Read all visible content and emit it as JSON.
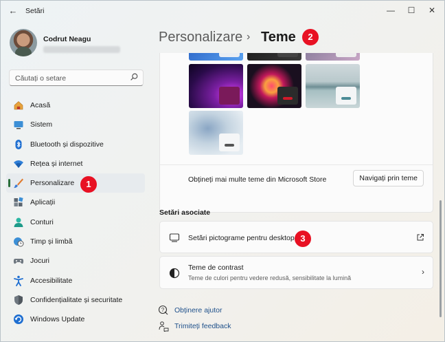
{
  "window": {
    "title": "Setări",
    "controls": [
      "minimize",
      "maximize",
      "close"
    ]
  },
  "user": {
    "name": "Codrut Neagu"
  },
  "search": {
    "placeholder": "Căutați o setare"
  },
  "sidebar": {
    "items": [
      {
        "label": "Acasă",
        "icon": "home-icon",
        "active": false
      },
      {
        "label": "Sistem",
        "icon": "system-icon",
        "active": false
      },
      {
        "label": "Bluetooth și dispozitive",
        "icon": "bluetooth-icon",
        "active": false
      },
      {
        "label": "Rețea și internet",
        "icon": "network-icon",
        "active": false
      },
      {
        "label": "Personalizare",
        "icon": "brush-icon",
        "active": true
      },
      {
        "label": "Aplicații",
        "icon": "apps-icon",
        "active": false
      },
      {
        "label": "Conturi",
        "icon": "account-icon",
        "active": false
      },
      {
        "label": "Timp și limbă",
        "icon": "clock-globe-icon",
        "active": false
      },
      {
        "label": "Jocuri",
        "icon": "gamepad-icon",
        "active": false
      },
      {
        "label": "Accesibilitate",
        "icon": "accessibility-icon",
        "active": false
      },
      {
        "label": "Confidențialitate și securitate",
        "icon": "shield-icon",
        "active": false
      },
      {
        "label": "Windows Update",
        "icon": "update-icon",
        "active": false
      }
    ]
  },
  "breadcrumb": {
    "parent": "Personalizare",
    "separator": "›",
    "current": "Teme"
  },
  "annotations": {
    "badge1": "1",
    "badge2": "2",
    "badge3": "3",
    "color": "#e81123"
  },
  "themes": {
    "more_text": "Obțineți mai multe teme din Microsoft Store",
    "browse_button": "Navigați prin teme"
  },
  "related": {
    "section_title": "Setări asociate",
    "desktop_icons": "Setări pictograme pentru desktop",
    "contrast_title": "Teme de contrast",
    "contrast_subtitle": "Teme de culori pentru vedere redusă, sensibilitate la lumină"
  },
  "help": {
    "get_help": "Obținere ajutor",
    "feedback": "Trimiteți feedback"
  },
  "colors": {
    "accent": "#2a6f3a",
    "link": "#1e4f8a"
  }
}
